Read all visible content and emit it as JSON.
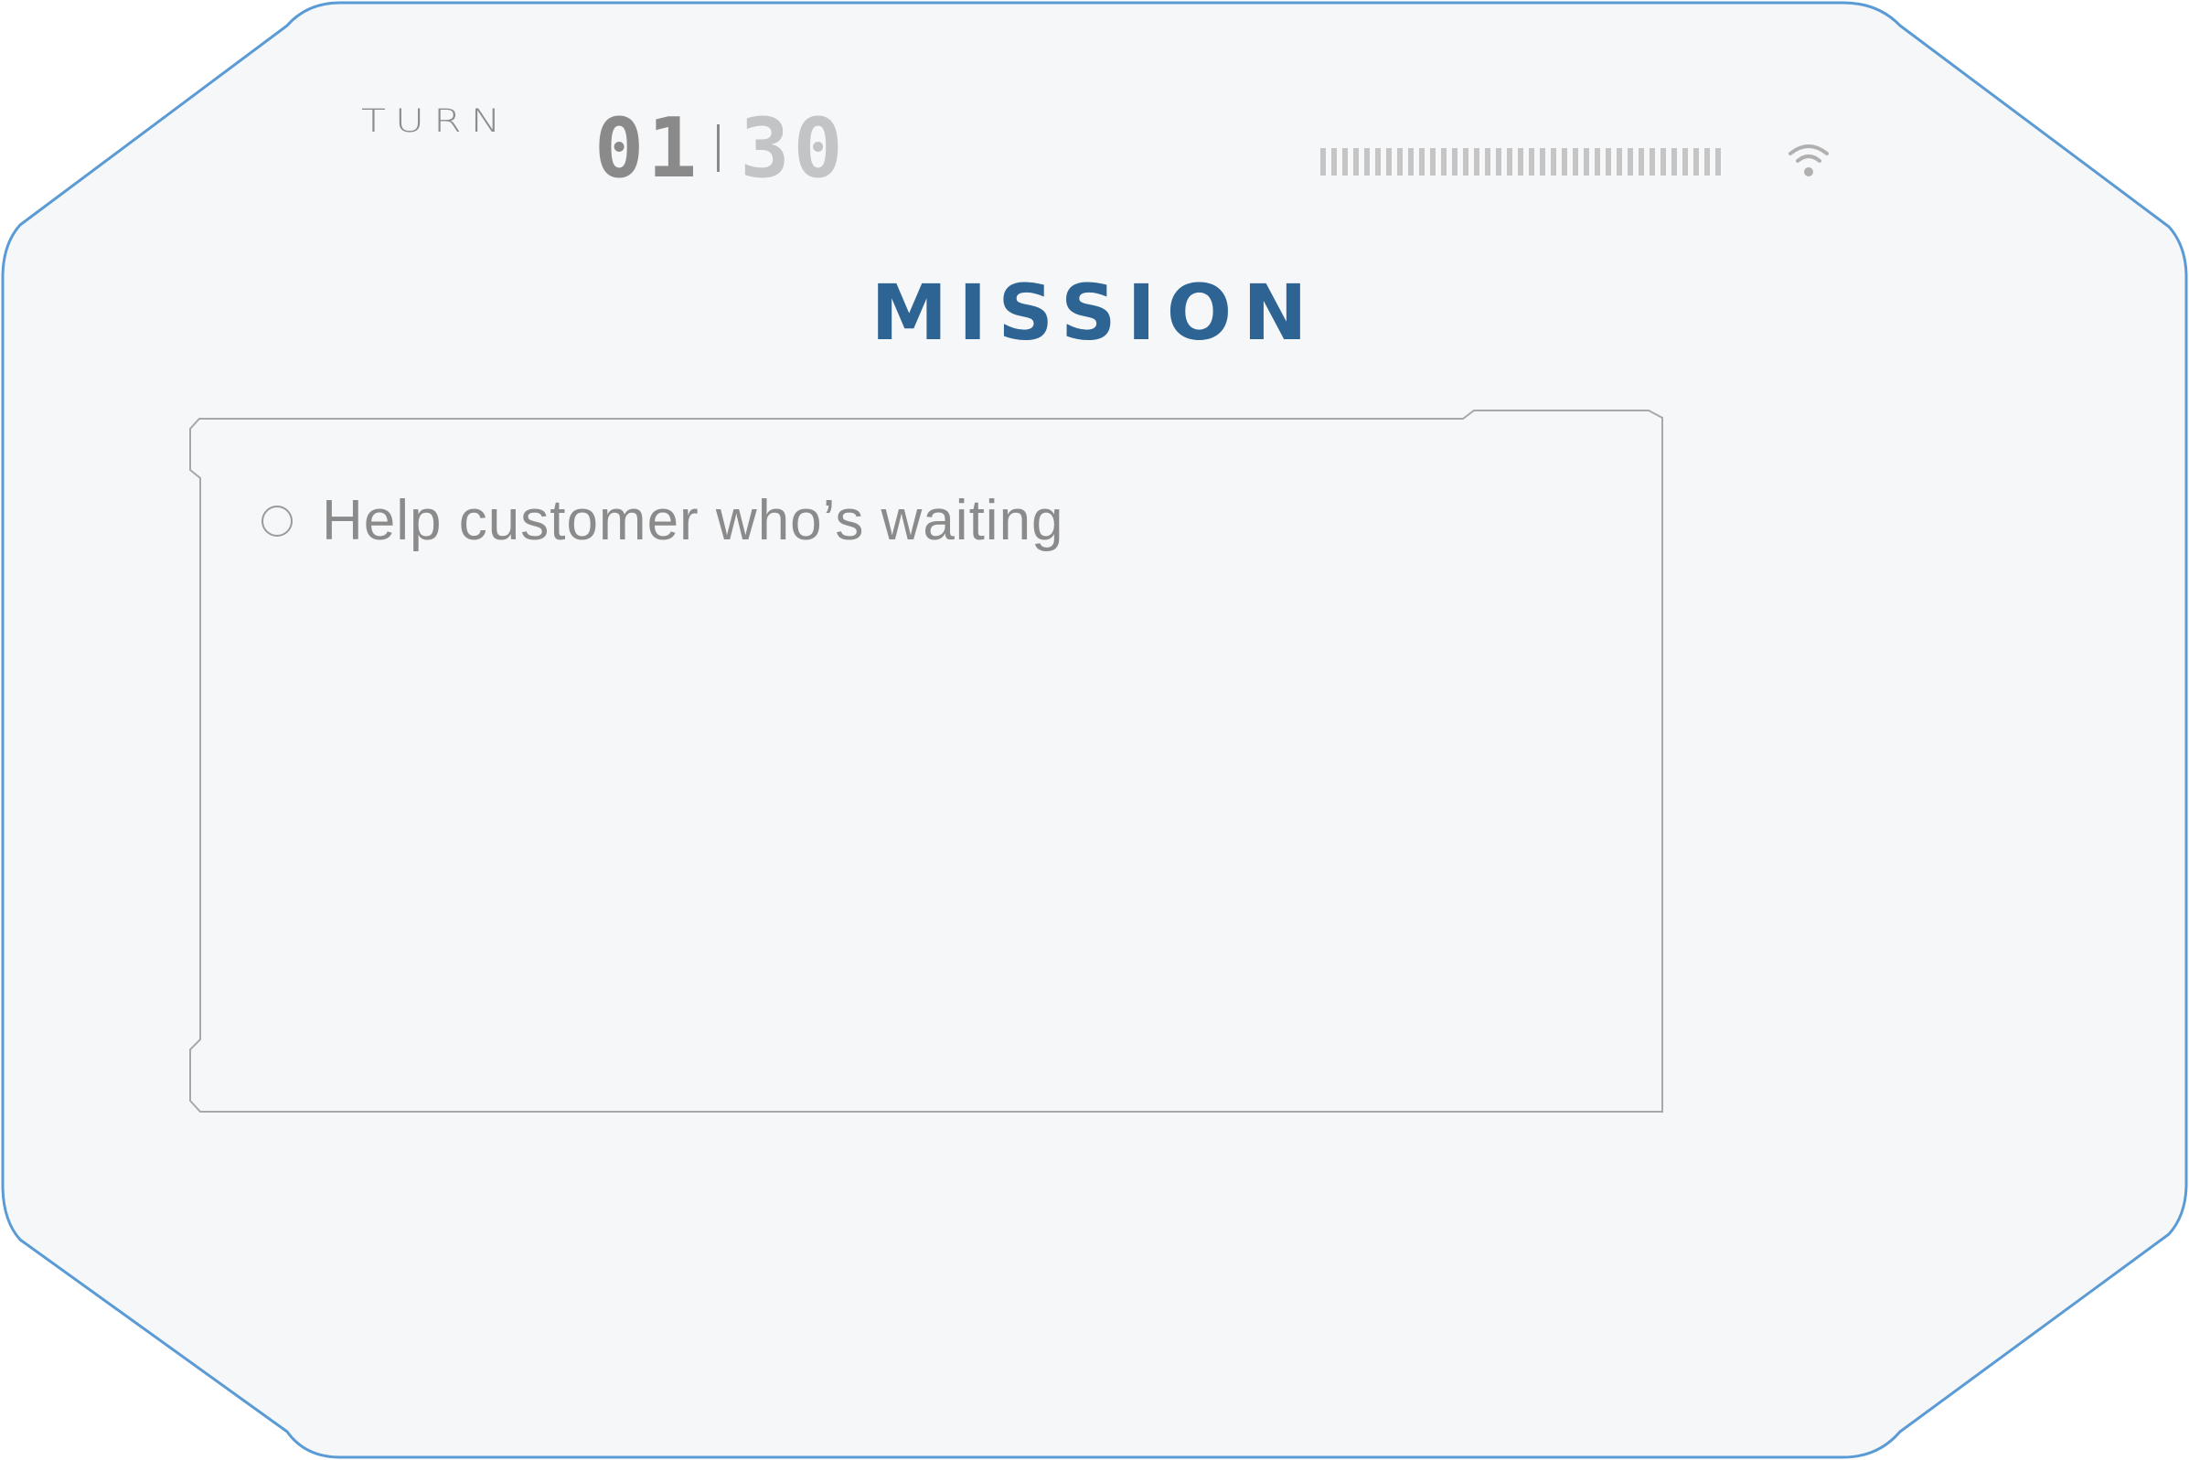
{
  "header": {
    "turn_label": "TURN",
    "timer_minutes": "01",
    "timer_seconds": "30",
    "signal_icon": "wifi-icon"
  },
  "title": "MISSION",
  "missions": [
    {
      "text": "Help customer who’s waiting",
      "checked": false
    }
  ],
  "colors": {
    "frame_border": "#5b9bd5",
    "background": "#f6f7f9",
    "title": "#2d6493",
    "text_gray": "#8b8b8b",
    "inactive_gray": "#c2c4c6"
  }
}
